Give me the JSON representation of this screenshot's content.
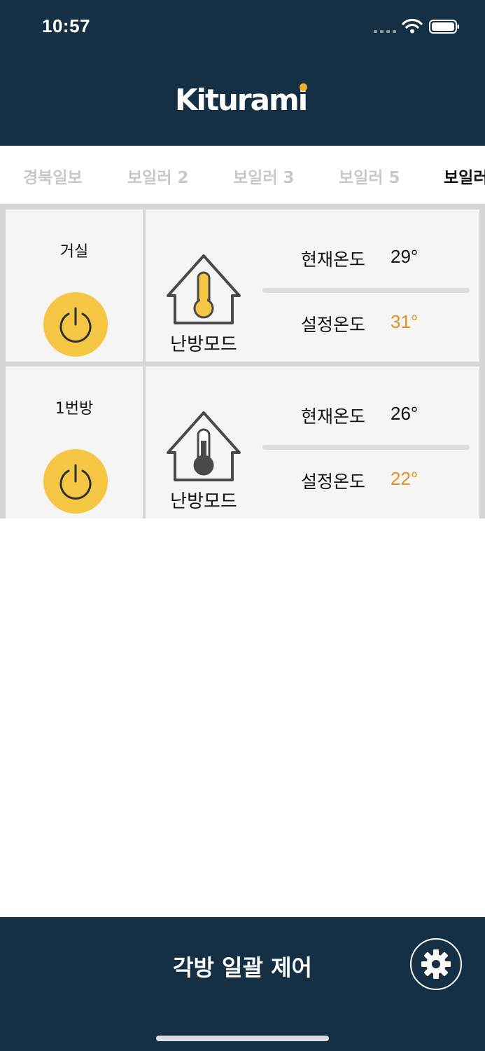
{
  "status_bar": {
    "time": "10:57",
    "signal_icon": "signal-dots-icon",
    "wifi_icon": "wifi-icon",
    "battery_icon": "battery-icon"
  },
  "header": {
    "logo_text": "Kiturami"
  },
  "tabs": [
    {
      "label": "경북일보",
      "active": false
    },
    {
      "label": "보일러 2",
      "active": false
    },
    {
      "label": "보일러 3",
      "active": false
    },
    {
      "label": "보일러 5",
      "active": false
    },
    {
      "label": "보일러",
      "active": true
    }
  ],
  "rooms": [
    {
      "name": "거실",
      "mode": "난방모드",
      "thermometer_color": "#f5c544",
      "current_label": "현재온도",
      "current_temp": "29°",
      "set_label": "설정온도",
      "set_temp": "31°"
    },
    {
      "name": "1번방",
      "mode": "난방모드",
      "thermometer_color": "#4a4a4a",
      "current_label": "현재온도",
      "current_temp": "26°",
      "set_label": "설정온도",
      "set_temp": "22°"
    }
  ],
  "footer": {
    "title": "각방 일괄 제어",
    "settings_icon": "gear-icon"
  },
  "colors": {
    "navy": "#152f45",
    "accent_yellow": "#f5c544",
    "set_temp_orange": "#e3922b",
    "logo_dot": "#f0b02a"
  }
}
